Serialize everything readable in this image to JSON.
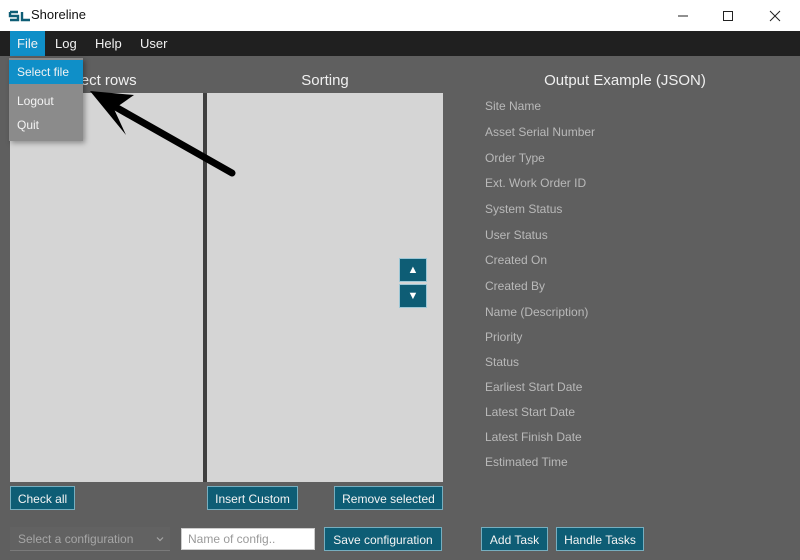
{
  "window": {
    "title": "Shoreline",
    "controls": [
      "minimize",
      "maximize",
      "close"
    ]
  },
  "menubar": {
    "items": [
      {
        "label": "File",
        "active": true
      },
      {
        "label": "Log"
      },
      {
        "label": "Help"
      },
      {
        "label": "User"
      }
    ]
  },
  "file_menu": {
    "items": [
      {
        "label": "Select file",
        "highlighted": true
      },
      {
        "label": "Logout"
      },
      {
        "label": "Quit"
      }
    ]
  },
  "sections": {
    "select_rows_title": "lect rows",
    "sorting_title": "Sorting",
    "output_title": "Output Example (JSON)"
  },
  "output_fields": [
    "Site Name",
    "Asset Serial Number",
    "Order Type",
    "Ext. Work Order ID",
    "System Status",
    "User Status",
    "Created On",
    "Created By",
    "Name (Description)",
    "Priority",
    "Status",
    "Earliest Start Date",
    "Latest Start Date",
    "Latest Finish Date",
    "Estimated Time"
  ],
  "buttons": {
    "check_all": "Check all",
    "insert_custom": "Insert Custom",
    "remove_selected": "Remove selected",
    "save_configuration": "Save configuration",
    "add_task": "Add Task",
    "handle_tasks": "Handle Tasks",
    "move_up": "▲",
    "move_down": "▼"
  },
  "config": {
    "select_placeholder": "Select a configuration",
    "name_placeholder": "Name of config.."
  },
  "colors": {
    "accent": "#0f8fc8",
    "button": "#0e5d75",
    "menubar": "#202020",
    "background": "#5f5f5f",
    "panel": "#d5d5d5"
  }
}
